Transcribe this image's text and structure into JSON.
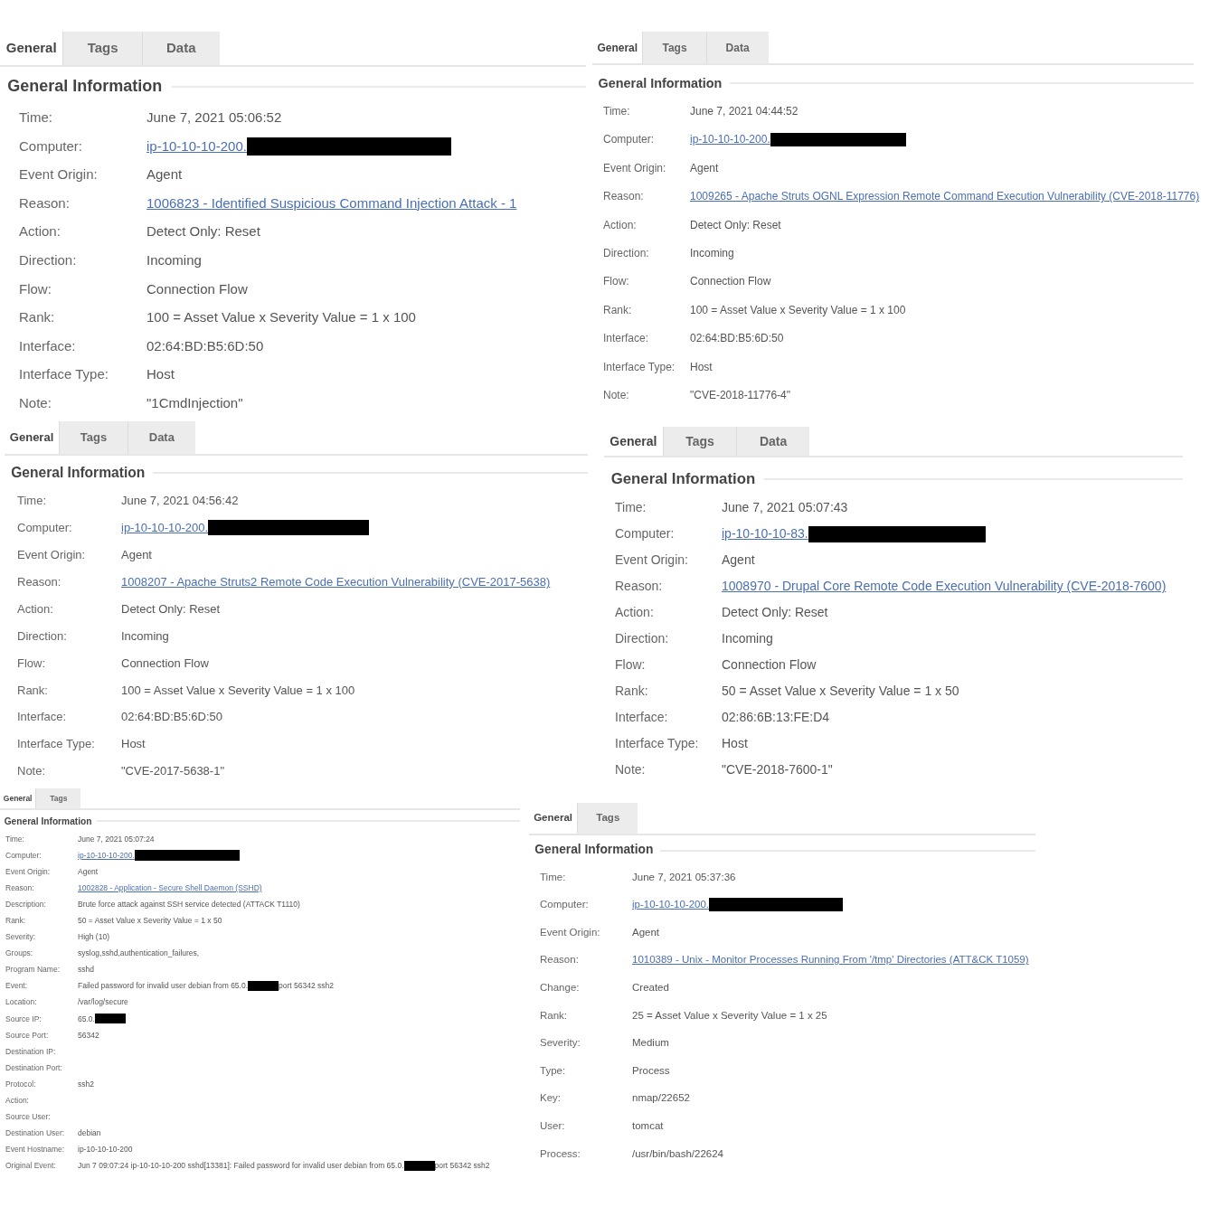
{
  "panels": [
    {
      "tabs": [
        {
          "label": "General",
          "selected": true
        },
        {
          "label": "Tags",
          "selected": false
        },
        {
          "label": "Data",
          "selected": false
        }
      ],
      "heading": "General Information",
      "fields": [
        {
          "label": "Time:",
          "parts": [
            {
              "kind": "text",
              "text": "June 7, 2021 05:06:52"
            }
          ]
        },
        {
          "label": "Computer:",
          "link": true,
          "parts": [
            {
              "kind": "text",
              "text": "ip-10-10-10-200."
            },
            {
              "kind": "redacted"
            }
          ]
        },
        {
          "label": "Event Origin:",
          "parts": [
            {
              "kind": "text",
              "text": "Agent"
            }
          ]
        },
        {
          "label": "Reason:",
          "link": true,
          "parts": [
            {
              "kind": "text",
              "text": "1006823 - Identified Suspicious Command Injection Attack - 1"
            }
          ]
        },
        {
          "label": "Action:",
          "parts": [
            {
              "kind": "text",
              "text": "Detect Only: Reset"
            }
          ]
        },
        {
          "label": "Direction:",
          "parts": [
            {
              "kind": "text",
              "text": "Incoming"
            }
          ]
        },
        {
          "label": "Flow:",
          "parts": [
            {
              "kind": "text",
              "text": "Connection Flow"
            }
          ]
        },
        {
          "label": "Rank:",
          "parts": [
            {
              "kind": "text",
              "text": "100 = Asset Value x Severity Value = 1 x 100"
            }
          ]
        },
        {
          "label": "Interface:",
          "parts": [
            {
              "kind": "text",
              "text": "02:64:BD:B5:6D:50"
            }
          ]
        },
        {
          "label": "Interface Type:",
          "parts": [
            {
              "kind": "text",
              "text": "Host"
            }
          ]
        },
        {
          "label": "Note:",
          "parts": [
            {
              "kind": "text",
              "text": "\"1CmdInjection\""
            }
          ]
        }
      ]
    },
    {
      "tabs": [
        {
          "label": "General",
          "selected": true
        },
        {
          "label": "Tags",
          "selected": false
        },
        {
          "label": "Data",
          "selected": false
        }
      ],
      "heading": "General Information",
      "fields": [
        {
          "label": "Time:",
          "parts": [
            {
              "kind": "text",
              "text": "June 7, 2021 04:44:52"
            }
          ]
        },
        {
          "label": "Computer:",
          "link": true,
          "parts": [
            {
              "kind": "text",
              "text": "ip-10-10-10-200."
            },
            {
              "kind": "redacted"
            }
          ]
        },
        {
          "label": "Event Origin:",
          "parts": [
            {
              "kind": "text",
              "text": "Agent"
            }
          ]
        },
        {
          "label": "Reason:",
          "link": true,
          "parts": [
            {
              "kind": "text",
              "text": "1009265 - Apache Struts OGNL Expression Remote Command Execution Vulnerability (CVE-2018-11776)"
            }
          ]
        },
        {
          "label": "Action:",
          "parts": [
            {
              "kind": "text",
              "text": "Detect Only: Reset"
            }
          ]
        },
        {
          "label": "Direction:",
          "parts": [
            {
              "kind": "text",
              "text": "Incoming"
            }
          ]
        },
        {
          "label": "Flow:",
          "parts": [
            {
              "kind": "text",
              "text": "Connection Flow"
            }
          ]
        },
        {
          "label": "Rank:",
          "parts": [
            {
              "kind": "text",
              "text": "100 = Asset Value x Severity Value = 1 x 100"
            }
          ]
        },
        {
          "label": "Interface:",
          "parts": [
            {
              "kind": "text",
              "text": "02:64:BD:B5:6D:50"
            }
          ]
        },
        {
          "label": "Interface Type:",
          "parts": [
            {
              "kind": "text",
              "text": "Host"
            }
          ]
        },
        {
          "label": "Note:",
          "parts": [
            {
              "kind": "text",
              "text": "\"CVE-2018-11776-4\""
            }
          ]
        }
      ]
    },
    {
      "tabs": [
        {
          "label": "General",
          "selected": true
        },
        {
          "label": "Tags",
          "selected": false
        },
        {
          "label": "Data",
          "selected": false
        }
      ],
      "heading": "General Information",
      "fields": [
        {
          "label": "Time:",
          "parts": [
            {
              "kind": "text",
              "text": "June 7, 2021 04:56:42"
            }
          ]
        },
        {
          "label": "Computer:",
          "link": true,
          "parts": [
            {
              "kind": "text",
              "text": "ip-10-10-10-200."
            },
            {
              "kind": "redacted"
            }
          ]
        },
        {
          "label": "Event Origin:",
          "parts": [
            {
              "kind": "text",
              "text": "Agent"
            }
          ]
        },
        {
          "label": "Reason:",
          "link": true,
          "parts": [
            {
              "kind": "text",
              "text": "1008207 - Apache Struts2 Remote Code Execution Vulnerability (CVE-2017-5638)"
            }
          ]
        },
        {
          "label": "Action:",
          "parts": [
            {
              "kind": "text",
              "text": "Detect Only: Reset"
            }
          ]
        },
        {
          "label": "Direction:",
          "parts": [
            {
              "kind": "text",
              "text": "Incoming"
            }
          ]
        },
        {
          "label": "Flow:",
          "parts": [
            {
              "kind": "text",
              "text": "Connection Flow"
            }
          ]
        },
        {
          "label": "Rank:",
          "parts": [
            {
              "kind": "text",
              "text": "100 = Asset Value x Severity Value = 1 x 100"
            }
          ]
        },
        {
          "label": "Interface:",
          "parts": [
            {
              "kind": "text",
              "text": "02:64:BD:B5:6D:50"
            }
          ]
        },
        {
          "label": "Interface Type:",
          "parts": [
            {
              "kind": "text",
              "text": "Host"
            }
          ]
        },
        {
          "label": "Note:",
          "parts": [
            {
              "kind": "text",
              "text": "\"CVE-2017-5638-1\""
            }
          ]
        }
      ]
    },
    {
      "tabs": [
        {
          "label": "General",
          "selected": true
        },
        {
          "label": "Tags",
          "selected": false
        },
        {
          "label": "Data",
          "selected": false
        }
      ],
      "heading": "General Information",
      "fields": [
        {
          "label": "Time:",
          "parts": [
            {
              "kind": "text",
              "text": "June 7, 2021 05:07:43"
            }
          ]
        },
        {
          "label": "Computer:",
          "link": true,
          "parts": [
            {
              "kind": "text",
              "text": "ip-10-10-10-83."
            },
            {
              "kind": "redacted"
            }
          ]
        },
        {
          "label": "Event Origin:",
          "parts": [
            {
              "kind": "text",
              "text": "Agent"
            }
          ]
        },
        {
          "label": "Reason:",
          "link": true,
          "parts": [
            {
              "kind": "text",
              "text": "1008970 - Drupal Core Remote Code Execution Vulnerability (CVE-2018-7600)"
            }
          ]
        },
        {
          "label": "Action:",
          "parts": [
            {
              "kind": "text",
              "text": "Detect Only: Reset"
            }
          ]
        },
        {
          "label": "Direction:",
          "parts": [
            {
              "kind": "text",
              "text": "Incoming"
            }
          ]
        },
        {
          "label": "Flow:",
          "parts": [
            {
              "kind": "text",
              "text": "Connection Flow"
            }
          ]
        },
        {
          "label": "Rank:",
          "parts": [
            {
              "kind": "text",
              "text": "50 = Asset Value x Severity Value = 1 x 50"
            }
          ]
        },
        {
          "label": "Interface:",
          "parts": [
            {
              "kind": "text",
              "text": "02:86:6B:13:FE:D4"
            }
          ]
        },
        {
          "label": "Interface Type:",
          "parts": [
            {
              "kind": "text",
              "text": "Host"
            }
          ]
        },
        {
          "label": "Note:",
          "parts": [
            {
              "kind": "text",
              "text": "\"CVE-2018-7600-1\""
            }
          ]
        }
      ]
    },
    {
      "tabs": [
        {
          "label": "General",
          "selected": true
        },
        {
          "label": "Tags",
          "selected": false
        }
      ],
      "heading": "General Information",
      "fields": [
        {
          "label": "Time:",
          "parts": [
            {
              "kind": "text",
              "text": "June 7, 2021 05:07:24"
            }
          ]
        },
        {
          "label": "Computer:",
          "link": true,
          "parts": [
            {
              "kind": "text",
              "text": "ip-10-10-10-200."
            },
            {
              "kind": "redacted"
            }
          ]
        },
        {
          "label": "Event Origin:",
          "parts": [
            {
              "kind": "text",
              "text": "Agent"
            }
          ]
        },
        {
          "label": "Reason:",
          "link": true,
          "parts": [
            {
              "kind": "text",
              "text": "1002828 - Application - Secure Shell Daemon (SSHD)"
            }
          ]
        },
        {
          "label": "Description:",
          "parts": [
            {
              "kind": "text",
              "text": "Brute force attack against SSH service detected (ATTACK T1110)"
            }
          ]
        },
        {
          "label": "Rank:",
          "parts": [
            {
              "kind": "text",
              "text": "50 = Asset Value x Severity Value = 1 x 50"
            }
          ]
        },
        {
          "label": "Severity:",
          "parts": [
            {
              "kind": "text",
              "text": "High (10)"
            }
          ]
        },
        {
          "label": "Groups:",
          "parts": [
            {
              "kind": "text",
              "text": "syslog,sshd,authentication_failures,"
            }
          ]
        },
        {
          "label": "Program Name:",
          "parts": [
            {
              "kind": "text",
              "text": "sshd"
            }
          ]
        },
        {
          "label": "Event:",
          "parts": [
            {
              "kind": "text",
              "text": "Failed password for invalid user debian from 65.0."
            },
            {
              "kind": "redacted"
            },
            {
              "kind": "text",
              "text": "port 56342 ssh2"
            }
          ]
        },
        {
          "label": "Location:",
          "parts": [
            {
              "kind": "text",
              "text": "/var/log/secure"
            }
          ]
        },
        {
          "label": "Source IP:",
          "parts": [
            {
              "kind": "text",
              "text": "65.0."
            },
            {
              "kind": "redacted"
            }
          ]
        },
        {
          "label": "Source Port:",
          "parts": [
            {
              "kind": "text",
              "text": "56342"
            }
          ]
        },
        {
          "label": "Destination IP:"
        },
        {
          "label": "Destination Port:"
        },
        {
          "label": "Protocol:",
          "parts": [
            {
              "kind": "text",
              "text": "ssh2"
            }
          ]
        },
        {
          "label": "Action:"
        },
        {
          "label": "Source User:"
        },
        {
          "label": "Destination User:",
          "parts": [
            {
              "kind": "text",
              "text": "debian"
            }
          ]
        },
        {
          "label": "Event Hostname:",
          "parts": [
            {
              "kind": "text",
              "text": "ip-10-10-10-200"
            }
          ]
        },
        {
          "label": "Original Event:",
          "parts": [
            {
              "kind": "text",
              "text": "Jun 7 09:07:24 ip-10-10-10-200 sshd[13381]: Failed password for invalid user debian from 65.0."
            },
            {
              "kind": "redacted"
            },
            {
              "kind": "text",
              "text": "port 56342 ssh2"
            }
          ]
        }
      ]
    },
    {
      "tabs": [
        {
          "label": "General",
          "selected": true
        },
        {
          "label": "Tags",
          "selected": false
        }
      ],
      "heading": "General Information",
      "fields": [
        {
          "label": "Time:",
          "parts": [
            {
              "kind": "text",
              "text": "June 7, 2021 05:37:36"
            }
          ]
        },
        {
          "label": "Computer:",
          "link": true,
          "parts": [
            {
              "kind": "text",
              "text": "ip-10-10-10-200."
            },
            {
              "kind": "redacted"
            }
          ]
        },
        {
          "label": "Event Origin:",
          "parts": [
            {
              "kind": "text",
              "text": "Agent"
            }
          ]
        },
        {
          "label": "Reason:",
          "link": true,
          "parts": [
            {
              "kind": "text",
              "text": "1010389 - Unix - Monitor Processes Running From '/tmp' Directories (ATT&CK T1059)"
            }
          ]
        },
        {
          "label": "Change:",
          "parts": [
            {
              "kind": "text",
              "text": "Created"
            }
          ]
        },
        {
          "label": "Rank:",
          "parts": [
            {
              "kind": "text",
              "text": "25 = Asset Value x Severity Value = 1 x 25"
            }
          ]
        },
        {
          "label": "Severity:",
          "parts": [
            {
              "kind": "text",
              "text": "Medium"
            }
          ]
        },
        {
          "label": "Type:",
          "parts": [
            {
              "kind": "text",
              "text": "Process"
            }
          ]
        },
        {
          "label": "Key:",
          "parts": [
            {
              "kind": "text",
              "text": "nmap/22652"
            }
          ]
        },
        {
          "label": "User:",
          "parts": [
            {
              "kind": "text",
              "text": "tomcat"
            }
          ]
        },
        {
          "label": "Process:",
          "parts": [
            {
              "kind": "text",
              "text": "/usr/bin/bash/22624"
            }
          ]
        }
      ]
    }
  ]
}
